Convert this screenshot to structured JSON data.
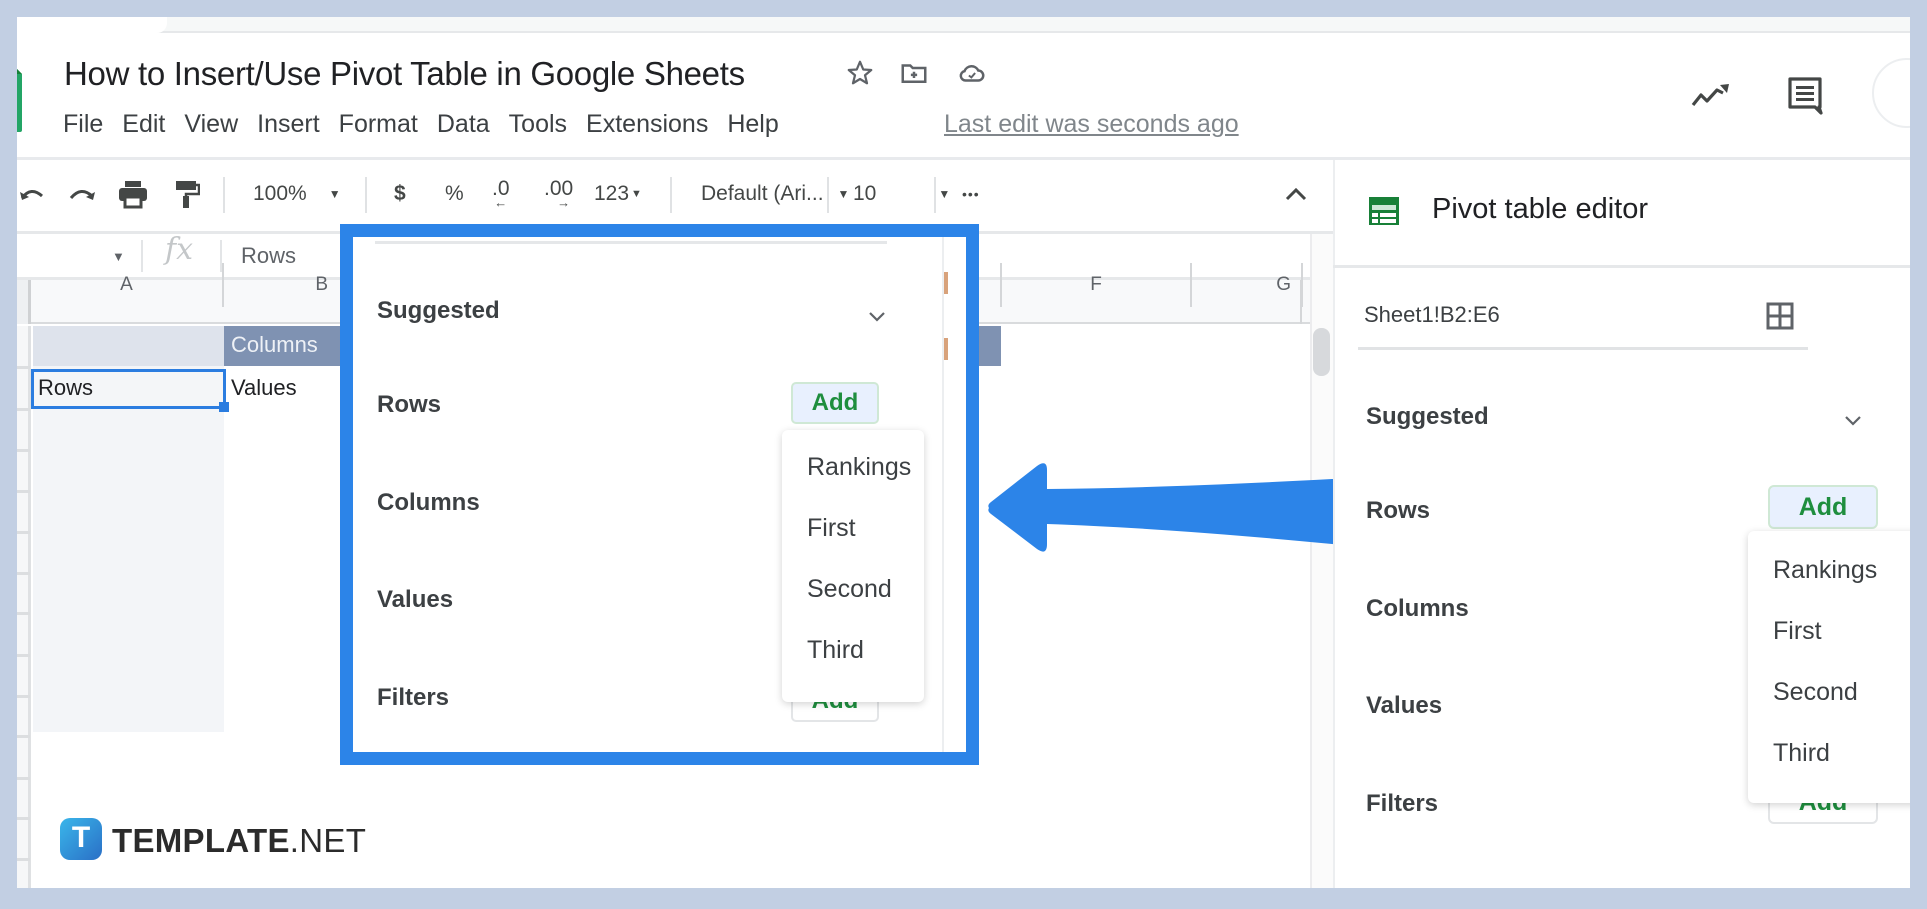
{
  "document": {
    "title": "How to Insert/Use Pivot Table in Google Sheets",
    "last_edit": "Last edit was seconds ago"
  },
  "menu": [
    "File",
    "Edit",
    "View",
    "Insert",
    "Format",
    "Data",
    "Tools",
    "Extensions",
    "Help"
  ],
  "toolbar": {
    "zoom": "100%",
    "currency": "$",
    "percent": "%",
    "decrease_decimal": ".0",
    "increase_decimal": ".00",
    "number_format": "123",
    "font": "Default (Ari...",
    "font_size": "10",
    "more": "•••"
  },
  "formula_bar": {
    "fx": "fx",
    "value": "Rows"
  },
  "grid": {
    "columns": [
      "A",
      "B",
      "F",
      "G"
    ],
    "cells": {
      "B1": "Columns",
      "A2": "Rows",
      "B2": "Values"
    }
  },
  "pivot_editor": {
    "title": "Pivot table editor",
    "range": "Sheet1!B2:E6",
    "sections": {
      "suggested": "Suggested",
      "rows": "Rows",
      "columns": "Columns",
      "values": "Values",
      "filters": "Filters"
    },
    "add_label": "Add",
    "dropdown_options": [
      "Rankings",
      "First",
      "Second",
      "Third"
    ]
  },
  "highlight": {
    "color": "#2c84e8"
  },
  "watermark": {
    "brand_bold": "TEMPLATE",
    "brand_suffix": ".NET",
    "mark": "T"
  }
}
